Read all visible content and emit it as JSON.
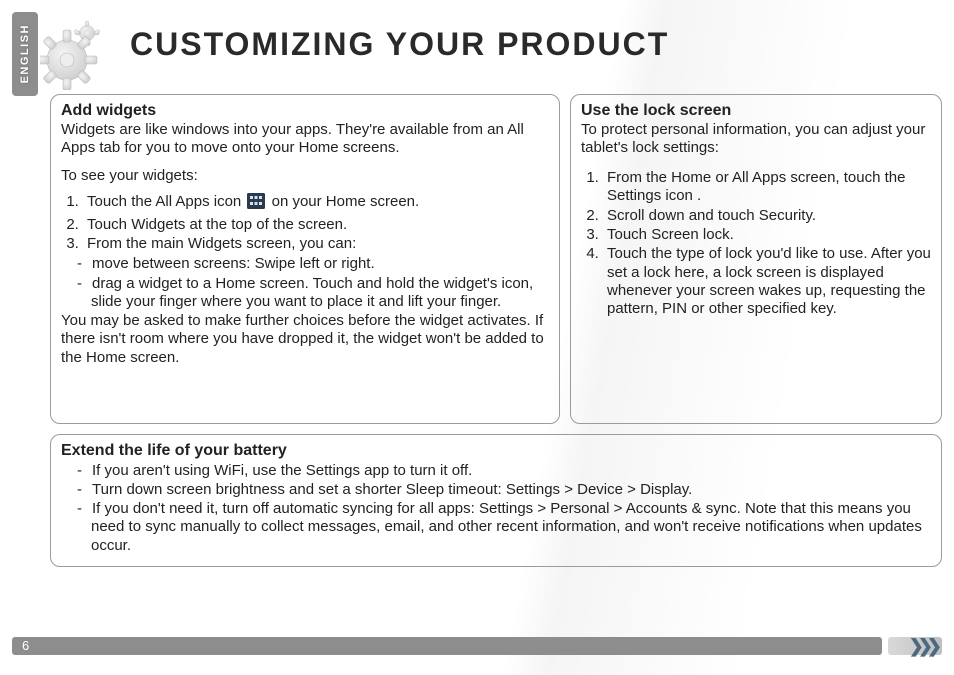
{
  "language_tab": "ENGLISH",
  "page_title": "CUSTOMIZING YOUR PRODUCT",
  "page_number": "6",
  "widgets": {
    "heading": "Add widgets",
    "intro": "Widgets are like windows into your apps. They're available from an All Apps tab for you to move onto your Home screens.",
    "lead": "To see your widgets:",
    "steps": {
      "s1a": "Touch the All Apps icon ",
      "s1b": " on your Home screen.",
      "s2": "Touch Widgets at the top of the screen.",
      "s3": " From the main Widgets screen, you can:"
    },
    "bullets": {
      "b1": "move between screens: Swipe left or right.",
      "b2": "drag a widget to a Home screen. Touch and hold the widget's icon, slide your finger where you want to place it and lift your finger."
    },
    "outro": "You may be asked to make further choices before the widget activates. If there isn't room where you have dropped it, the widget won't be added to the Home screen.",
    "icon_name": "all-apps-icon"
  },
  "lockscreen": {
    "heading": "Use the lock screen",
    "intro": "To protect personal information, you can adjust your tablet's lock settings:",
    "steps": {
      "s1": "From the Home or All Apps screen, touch the Settings icon .",
      "s2": "Scroll down and touch Security.",
      "s3": "Touch Screen lock.",
      "s4": "Touch the type of lock you'd like to use. After you set a lock here, a lock screen is displayed whenever your screen wakes up, requesting the pattern, PIN or other specified key."
    }
  },
  "battery": {
    "heading": "Extend the life of your battery",
    "bullets": {
      "b1": "If you aren't using WiFi, use the Settings app to turn it off.",
      "b2": "Turn down screen brightness and set a shorter Sleep timeout: Settings > Device > Display.",
      "b3": "If you don't need it, turn off automatic syncing for all apps: Settings > Personal > Accounts & sync. Note that this means you need to sync manually to collect messages, email, and other recent information, and won't receive notifications when updates occur."
    }
  }
}
